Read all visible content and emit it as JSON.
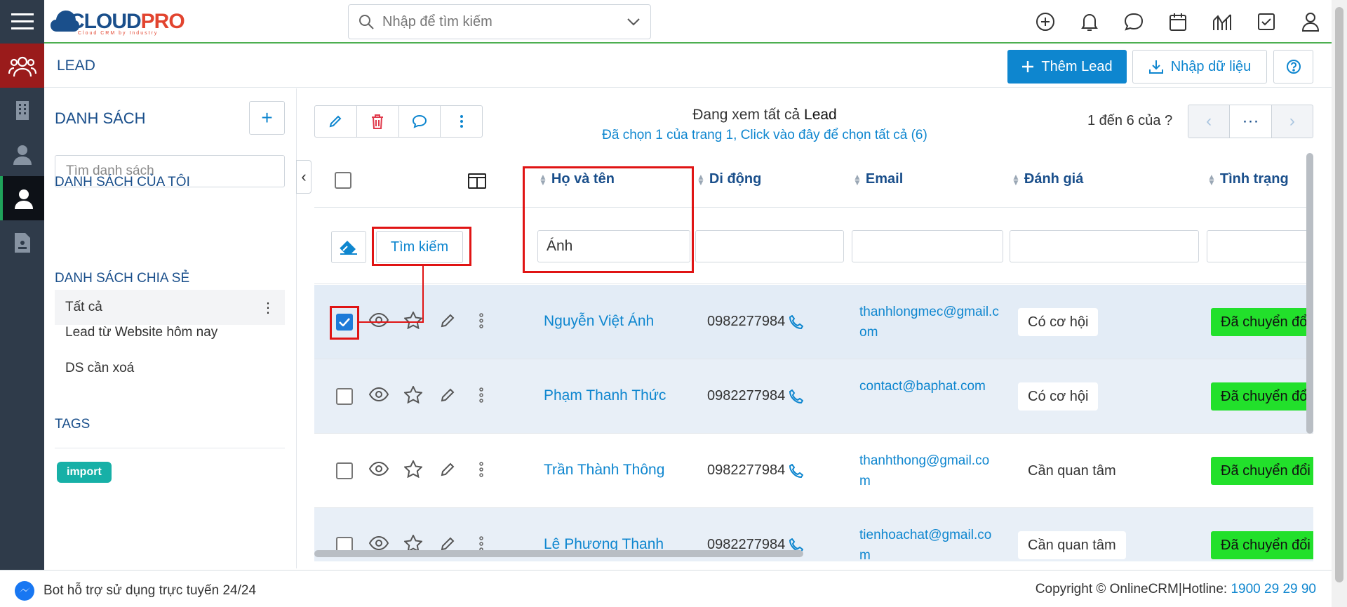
{
  "header": {
    "logo": {
      "main": "CLOUD",
      "accent": "PRO",
      "tagline": "Cloud CRM by Industry"
    },
    "search_placeholder": "Nhập để tìm kiếm",
    "icons": [
      "plus-circle-icon",
      "bell-icon",
      "chat-icon",
      "calendar-icon",
      "report-icon",
      "task-icon",
      "user-icon"
    ]
  },
  "page": {
    "title": "LEAD",
    "add_button": "Thêm Lead",
    "import_button": "Nhập dữ liệu"
  },
  "list_panel": {
    "heading": "DANH SÁCH",
    "search_placeholder": "Tìm danh sách",
    "my_lists_heading": "DANH SÁCH CỦA TÔI",
    "my_lists": [
      "Lead từ Website hôm nay",
      "DS cần xoá"
    ],
    "shared_heading": "DANH SÁCH CHIA SẺ",
    "shared_lists": [
      "Tất cả"
    ],
    "tags_heading": "TAGS",
    "tags": [
      "import"
    ]
  },
  "main": {
    "viewing_prefix": "Đang xem tất cả",
    "viewing_entity": "Lead",
    "selection_note": "Đã chọn 1 của trang 1, Click vào đây để chọn tất cả (6)",
    "pager_info": "1 đến 6 của",
    "pager_question": "?",
    "columns": [
      "Họ và tên",
      "Di động",
      "Email",
      "Đánh giá",
      "Tình trạng"
    ],
    "filter_search_button": "Tìm kiếm",
    "filter_name_value": "Ánh",
    "rows": [
      {
        "name": "Nguyễn Việt Ánh",
        "phone": "0982277984",
        "email": "thanhlongmec@gmail.com",
        "rating": "Có cơ hội",
        "status": "Đã chuyển đổi",
        "checked": true
      },
      {
        "name": "Phạm Thanh Thức",
        "phone": "0982277984",
        "email": "contact@baphat.com",
        "rating": "Có cơ hội",
        "status": "Đã chuyển đổi",
        "checked": false
      },
      {
        "name": "Trần Thành Thông",
        "phone": "0982277984",
        "email": "thanhthong@gmail.com",
        "rating": "Cần quan tâm",
        "status": "Đã chuyển đổi",
        "checked": false
      },
      {
        "name": "Lê Phương Thanh",
        "phone": "0982277984",
        "email": "tienhoachat@gmail.com",
        "rating": "Cần quan tâm",
        "status": "Đã chuyển đổi",
        "checked": false
      }
    ]
  },
  "footer": {
    "bot_text": "Bot hỗ trợ sử dụng trực tuyến 24/24",
    "copyright": "Copyright © OnlineCRM|Hotline:",
    "hotline": "1900 29 29 90"
  },
  "colors": {
    "primary": "#0e86cf",
    "brand": "#1a4f8b",
    "status": "#22e02b",
    "highlight": "#e01414"
  }
}
